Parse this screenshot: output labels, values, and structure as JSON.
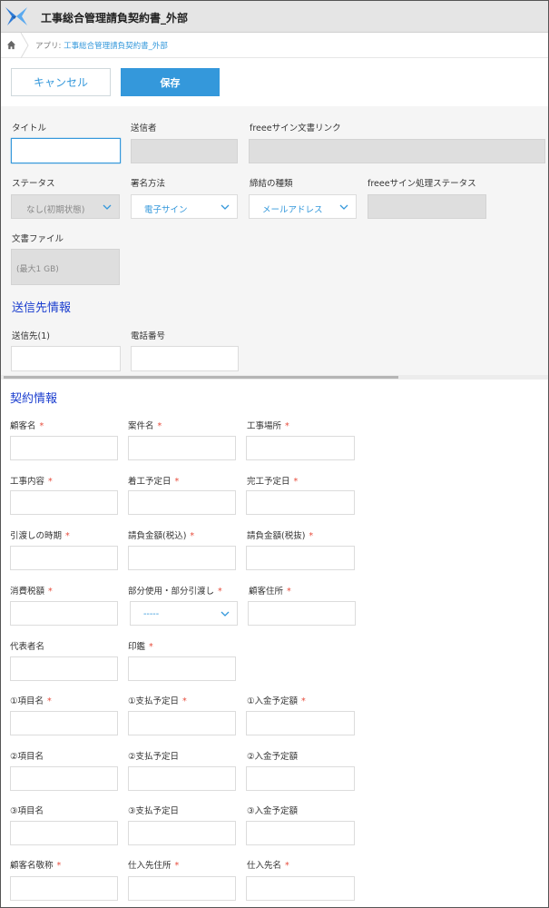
{
  "header": {
    "title": "工事総合管理請負契約書_外部",
    "logo_icon": "app-logo-icon"
  },
  "breadcrumb": {
    "prefix": "アプリ: ",
    "app_link": "工事総合管理請負契約書_外部"
  },
  "toolbar": {
    "cancel_label": "キャンセル",
    "save_label": "保存"
  },
  "form_top": {
    "title_label": "タイトル",
    "sender_label": "送信者",
    "freee_link_label": "freeeサイン文書リンク",
    "status_label": "ステータス",
    "status_value": "なし(初期状態)",
    "sign_method_label": "署名方法",
    "sign_method_value": "電子サイン",
    "contract_type_label": "締結の種類",
    "contract_type_value": "メールアドレス",
    "freee_status_label": "freeeサイン処理ステータス",
    "doc_file_label": "文書ファイル",
    "doc_file_hint": "(最大1 GB)",
    "recipient_section": "送信先情報",
    "recipient_label": "送信先(1)",
    "phone_label": "電話番号"
  },
  "contract": {
    "section": "契約情報",
    "fields": [
      {
        "label": "顧客名",
        "required": true
      },
      {
        "label": "案件名",
        "required": true
      },
      {
        "label": "工事場所",
        "required": true
      },
      {
        "label": "工事内容",
        "required": true
      },
      {
        "label": "着工予定日",
        "required": true
      },
      {
        "label": "完工予定日",
        "required": true
      },
      {
        "label": "引渡しの時期",
        "required": true
      },
      {
        "label": "請負金額(税込)",
        "required": true
      },
      {
        "label": "請負金額(税抜)",
        "required": true
      },
      {
        "label": "消費税額",
        "required": true
      },
      {
        "label": "部分使用・部分引渡し",
        "required": true,
        "select_value": "-----"
      },
      {
        "label": "顧客住所",
        "required": true
      },
      {
        "label": "代表者名",
        "required": false
      },
      {
        "label": "印鑑",
        "required": true
      },
      {
        "label": "①項目名",
        "required": true
      },
      {
        "label": "①支払予定日",
        "required": true
      },
      {
        "label": "①入金予定額",
        "required": true
      },
      {
        "label": "②項目名",
        "required": false
      },
      {
        "label": "②支払予定日",
        "required": false
      },
      {
        "label": "②入金予定額",
        "required": false
      },
      {
        "label": "③項目名",
        "required": false
      },
      {
        "label": "③支払予定日",
        "required": false
      },
      {
        "label": "③入金予定額",
        "required": false
      },
      {
        "label": "顧客名敬称",
        "required": true
      },
      {
        "label": "仕入先住所",
        "required": true
      },
      {
        "label": "仕入先名",
        "required": true
      }
    ],
    "required_mark": "*"
  },
  "colors": {
    "accent": "#3498db",
    "required": "#e74c3c",
    "section_title": "#1c3fcf"
  }
}
